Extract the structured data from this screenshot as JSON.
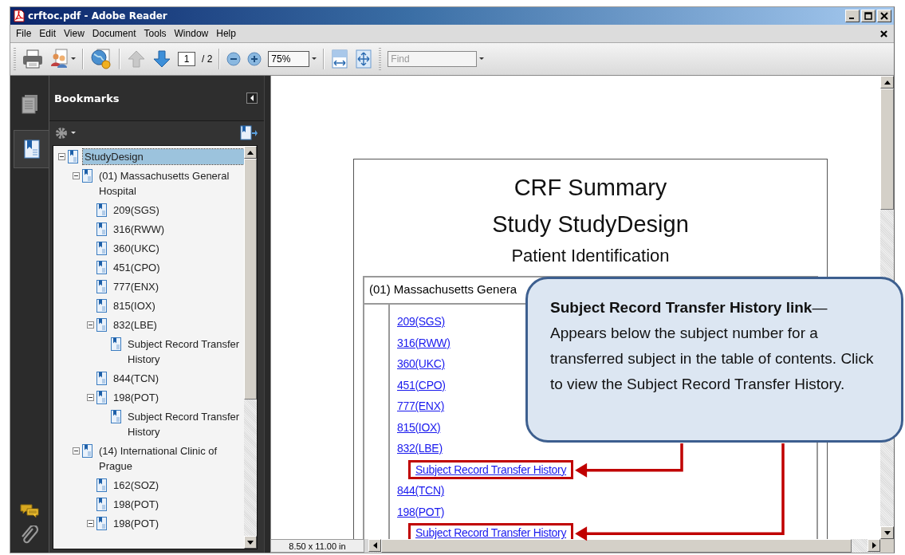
{
  "window": {
    "title": "crftoc.pdf - Adobe Reader"
  },
  "menu": [
    "File",
    "Edit",
    "View",
    "Document",
    "Tools",
    "Window",
    "Help"
  ],
  "toolbar": {
    "page_buttons": [
      {
        "kind": "previous",
        "disabled": true
      },
      {
        "kind": "next",
        "disabled": false
      }
    ],
    "page_number": "1",
    "page_total": "/ 2",
    "zoom": "75%",
    "find": {
      "placeholder": "Find"
    }
  },
  "nav_tabs": [
    {
      "kind": "pages",
      "selected": false
    },
    {
      "kind": "bookmarks",
      "selected": true
    }
  ],
  "bookmarks": {
    "title": "Bookmarks",
    "tree": [
      {
        "label": "StudyDesign",
        "selected": true,
        "expanded": true,
        "children": [
          {
            "label": "(01) Massachusetts General Hospital",
            "selected": false,
            "expanded": true,
            "children": [
              {
                "label": "209(SGS)",
                "selected": false
              },
              {
                "label": "316(RWW)",
                "selected": false
              },
              {
                "label": "360(UKC)",
                "selected": false
              },
              {
                "label": "451(CPO)",
                "selected": false
              },
              {
                "label": "777(ENX)",
                "selected": false
              },
              {
                "label": "815(IOX)",
                "selected": false
              },
              {
                "label": "832(LBE)",
                "selected": false,
                "expanded": true,
                "children": [
                  {
                    "label": "Subject Record Transfer History",
                    "selected": false
                  }
                ]
              },
              {
                "label": "844(TCN)",
                "selected": false
              },
              {
                "label": "198(POT)",
                "selected": false,
                "expanded": true,
                "children": [
                  {
                    "label": "Subject Record Transfer History",
                    "selected": false
                  }
                ]
              }
            ]
          },
          {
            "label": "(14) International Clinic of Prague",
            "selected": false,
            "expanded": true,
            "children": [
              {
                "label": "162(SOZ)",
                "selected": false
              },
              {
                "label": "198(POT)",
                "selected": false
              },
              {
                "label": "198(POT)",
                "selected": false,
                "expanded": true
              }
            ]
          }
        ]
      }
    ]
  },
  "document": {
    "titles": [
      "CRF Summary",
      "Study StudyDesign",
      "Patient Identification"
    ],
    "table_header": "(01) Massachusetts Genera",
    "links": [
      {
        "label": "209(SGS)",
        "kind": "subject",
        "highlighted": false
      },
      {
        "label": "316(RWW)",
        "kind": "subject",
        "highlighted": false
      },
      {
        "label": "360(UKC)",
        "kind": "subject",
        "highlighted": false
      },
      {
        "label": "451(CPO)",
        "kind": "subject",
        "highlighted": false
      },
      {
        "label": "777(ENX)",
        "kind": "subject",
        "highlighted": false
      },
      {
        "label": "815(IOX)",
        "kind": "subject",
        "highlighted": false
      },
      {
        "label": "832(LBE)",
        "kind": "subject",
        "highlighted": false
      },
      {
        "label": "Subject Record Transfer History",
        "kind": "transfer",
        "highlighted": true
      },
      {
        "label": "844(TCN)",
        "kind": "subject",
        "highlighted": false
      },
      {
        "label": "198(POT)",
        "kind": "subject",
        "highlighted": false
      },
      {
        "label": "Subject Record Transfer History",
        "kind": "transfer",
        "highlighted": true
      }
    ]
  },
  "page_size": "8.50 x 11.00 in",
  "callout": {
    "text": "**Subject Record Transfer History link**—Appears below the subject number for a transferred subject in the table of contents. Click to view the Subject Record Transfer History."
  }
}
